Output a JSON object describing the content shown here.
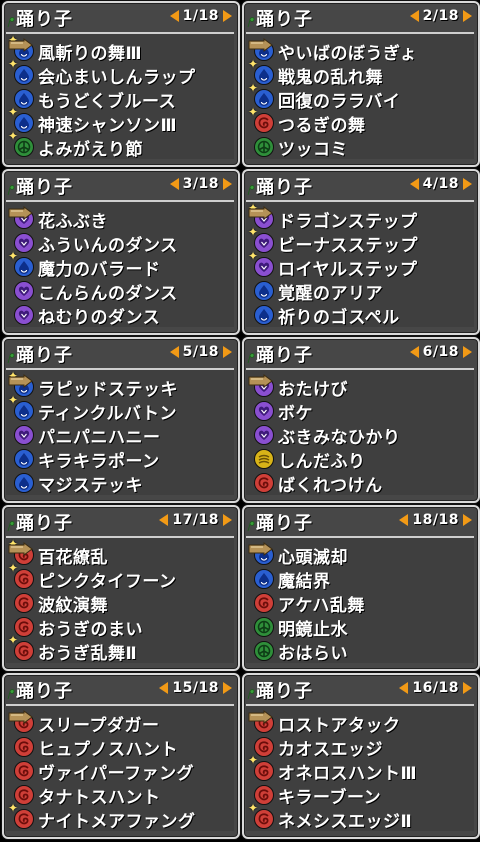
{
  "colors": {
    "blue": "#2a5fd1",
    "purple": "#8a4fd0",
    "green": "#2f8f3a",
    "red": "#cf3f38",
    "yellow": "#d8b318",
    "arrow": "#f29a16"
  },
  "panels": [
    {
      "title": "踊り子",
      "page": "1/18",
      "items": [
        {
          "label": "風斬りの舞Ⅲ",
          "icon": "blue-drop-icon",
          "color": "blue",
          "star": true,
          "cursor": true
        },
        {
          "label": "会心まいしんラップ",
          "icon": "blue-drop-icon",
          "color": "blue",
          "star": true
        },
        {
          "label": "もうどくブルース",
          "icon": "blue-drop-icon",
          "color": "blue"
        },
        {
          "label": "神速シャンソンⅢ",
          "icon": "blue-drop-icon",
          "color": "blue",
          "star": true
        },
        {
          "label": "よみがえり節",
          "icon": "green-tri-icon",
          "color": "green",
          "star": true
        }
      ]
    },
    {
      "title": "踊り子",
      "page": "2/18",
      "items": [
        {
          "label": "やいばのぼうぎょ",
          "icon": "blue-drop-icon",
          "color": "blue",
          "cursor": true
        },
        {
          "label": "戦鬼の乱れ舞",
          "icon": "blue-drop-icon",
          "color": "blue",
          "star": true
        },
        {
          "label": "回復のララバイ",
          "icon": "blue-drop-icon",
          "color": "blue",
          "star": true
        },
        {
          "label": "つるぎの舞",
          "icon": "red-swirl-icon",
          "color": "red",
          "star": true
        },
        {
          "label": "ツッコミ",
          "icon": "green-tri-icon",
          "color": "green"
        }
      ]
    },
    {
      "title": "踊り子",
      "page": "3/18",
      "items": [
        {
          "label": "花ふぶき",
          "icon": "purple-heart-icon",
          "color": "purple",
          "cursor": true
        },
        {
          "label": "ふういんのダンス",
          "icon": "purple-heart-icon",
          "color": "purple"
        },
        {
          "label": "魔力のバラード",
          "icon": "blue-drop-icon",
          "color": "blue",
          "star": true
        },
        {
          "label": "こんらんのダンス",
          "icon": "purple-heart-icon",
          "color": "purple"
        },
        {
          "label": "ねむりのダンス",
          "icon": "purple-heart-icon",
          "color": "purple"
        }
      ]
    },
    {
      "title": "踊り子",
      "page": "4/18",
      "items": [
        {
          "label": "ドラゴンステップ",
          "icon": "purple-heart-icon",
          "color": "purple",
          "star": true,
          "cursor": true
        },
        {
          "label": "ビーナスステップ",
          "icon": "purple-heart-icon",
          "color": "purple",
          "star": true
        },
        {
          "label": "ロイヤルステップ",
          "icon": "purple-heart-icon",
          "color": "purple",
          "star": true
        },
        {
          "label": "覚醒のアリア",
          "icon": "blue-drop-icon",
          "color": "blue"
        },
        {
          "label": "祈りのゴスペル",
          "icon": "blue-drop-icon",
          "color": "blue"
        }
      ]
    },
    {
      "title": "踊り子",
      "page": "5/18",
      "items": [
        {
          "label": "ラピッドステッキ",
          "icon": "blue-drop-icon",
          "color": "blue",
          "star": true,
          "cursor": true
        },
        {
          "label": "ティンクルバトン",
          "icon": "blue-drop-icon",
          "color": "blue",
          "star": true
        },
        {
          "label": "パニパニハニー",
          "icon": "purple-heart-icon",
          "color": "purple"
        },
        {
          "label": "キラキラポーン",
          "icon": "blue-drop-icon",
          "color": "blue"
        },
        {
          "label": "マジステッキ",
          "icon": "blue-drop-icon",
          "color": "blue"
        }
      ]
    },
    {
      "title": "踊り子",
      "page": "6/18",
      "items": [
        {
          "label": "おたけび",
          "icon": "purple-heart-icon",
          "color": "purple",
          "cursor": true
        },
        {
          "label": "ボケ",
          "icon": "purple-heart-icon",
          "color": "purple"
        },
        {
          "label": "ぶきみなひかり",
          "icon": "purple-heart-icon",
          "color": "purple"
        },
        {
          "label": "しんだふり",
          "icon": "yellow-stripe-icon",
          "color": "yellow"
        },
        {
          "label": "ばくれつけん",
          "icon": "red-swirl-icon",
          "color": "red"
        }
      ]
    },
    {
      "title": "踊り子",
      "page": "17/18",
      "items": [
        {
          "label": "百花繚乱",
          "icon": "red-swirl-icon",
          "color": "red",
          "star": true,
          "cursor": true
        },
        {
          "label": "ピンクタイフーン",
          "icon": "red-swirl-icon",
          "color": "red",
          "star": true
        },
        {
          "label": "波紋演舞",
          "icon": "red-swirl-icon",
          "color": "red"
        },
        {
          "label": "おうぎのまい",
          "icon": "red-swirl-icon",
          "color": "red"
        },
        {
          "label": "おうぎ乱舞Ⅱ",
          "icon": "red-swirl-icon",
          "color": "red",
          "star": true
        }
      ]
    },
    {
      "title": "踊り子",
      "page": "18/18",
      "items": [
        {
          "label": "心頭滅却",
          "icon": "blue-drop-icon",
          "color": "blue",
          "cursor": true
        },
        {
          "label": "魔結界",
          "icon": "blue-drop-icon",
          "color": "blue"
        },
        {
          "label": "アケハ乱舞",
          "icon": "red-swirl-icon",
          "color": "red"
        },
        {
          "label": "明鏡止水",
          "icon": "green-tri-icon",
          "color": "green"
        },
        {
          "label": "おはらい",
          "icon": "green-tri-icon",
          "color": "green"
        }
      ]
    },
    {
      "title": "踊り子",
      "page": "15/18",
      "items": [
        {
          "label": "スリープダガー",
          "icon": "red-swirl-icon",
          "color": "red",
          "cursor": true
        },
        {
          "label": "ヒュプノスハント",
          "icon": "red-swirl-icon",
          "color": "red"
        },
        {
          "label": "ヴァイパーファング",
          "icon": "red-swirl-icon",
          "color": "red"
        },
        {
          "label": "タナトスハント",
          "icon": "red-swirl-icon",
          "color": "red"
        },
        {
          "label": "ナイトメアファング",
          "icon": "red-swirl-icon",
          "color": "red",
          "star": true
        }
      ]
    },
    {
      "title": "踊り子",
      "page": "16/18",
      "items": [
        {
          "label": "ロストアタック",
          "icon": "red-swirl-icon",
          "color": "red",
          "cursor": true
        },
        {
          "label": "カオスエッジ",
          "icon": "red-swirl-icon",
          "color": "red"
        },
        {
          "label": "オネロスハントⅢ",
          "icon": "red-swirl-icon",
          "color": "red",
          "star": true
        },
        {
          "label": "キラーブーン",
          "icon": "red-swirl-icon",
          "color": "red"
        },
        {
          "label": "ネメシスエッジⅡ",
          "icon": "red-swirl-icon",
          "color": "red",
          "star": true
        }
      ]
    }
  ]
}
